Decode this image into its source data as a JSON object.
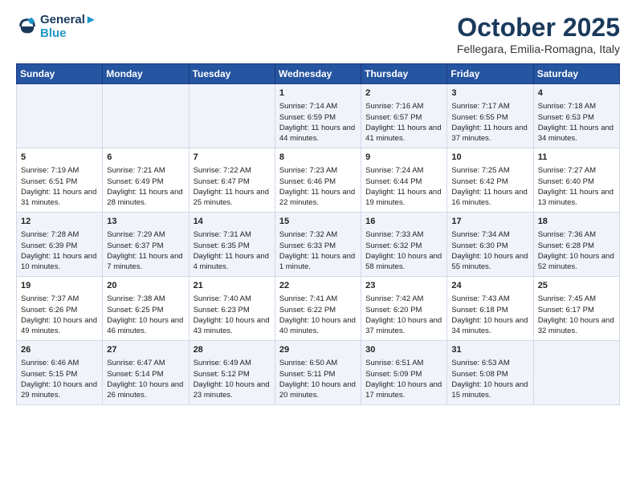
{
  "header": {
    "logo_line1": "General",
    "logo_line2": "Blue",
    "month": "October 2025",
    "location": "Fellegara, Emilia-Romagna, Italy"
  },
  "weekdays": [
    "Sunday",
    "Monday",
    "Tuesday",
    "Wednesday",
    "Thursday",
    "Friday",
    "Saturday"
  ],
  "weeks": [
    [
      {
        "day": "",
        "text": ""
      },
      {
        "day": "",
        "text": ""
      },
      {
        "day": "",
        "text": ""
      },
      {
        "day": "1",
        "text": "Sunrise: 7:14 AM\nSunset: 6:59 PM\nDaylight: 11 hours and 44 minutes."
      },
      {
        "day": "2",
        "text": "Sunrise: 7:16 AM\nSunset: 6:57 PM\nDaylight: 11 hours and 41 minutes."
      },
      {
        "day": "3",
        "text": "Sunrise: 7:17 AM\nSunset: 6:55 PM\nDaylight: 11 hours and 37 minutes."
      },
      {
        "day": "4",
        "text": "Sunrise: 7:18 AM\nSunset: 6:53 PM\nDaylight: 11 hours and 34 minutes."
      }
    ],
    [
      {
        "day": "5",
        "text": "Sunrise: 7:19 AM\nSunset: 6:51 PM\nDaylight: 11 hours and 31 minutes."
      },
      {
        "day": "6",
        "text": "Sunrise: 7:21 AM\nSunset: 6:49 PM\nDaylight: 11 hours and 28 minutes."
      },
      {
        "day": "7",
        "text": "Sunrise: 7:22 AM\nSunset: 6:47 PM\nDaylight: 11 hours and 25 minutes."
      },
      {
        "day": "8",
        "text": "Sunrise: 7:23 AM\nSunset: 6:46 PM\nDaylight: 11 hours and 22 minutes."
      },
      {
        "day": "9",
        "text": "Sunrise: 7:24 AM\nSunset: 6:44 PM\nDaylight: 11 hours and 19 minutes."
      },
      {
        "day": "10",
        "text": "Sunrise: 7:25 AM\nSunset: 6:42 PM\nDaylight: 11 hours and 16 minutes."
      },
      {
        "day": "11",
        "text": "Sunrise: 7:27 AM\nSunset: 6:40 PM\nDaylight: 11 hours and 13 minutes."
      }
    ],
    [
      {
        "day": "12",
        "text": "Sunrise: 7:28 AM\nSunset: 6:39 PM\nDaylight: 11 hours and 10 minutes."
      },
      {
        "day": "13",
        "text": "Sunrise: 7:29 AM\nSunset: 6:37 PM\nDaylight: 11 hours and 7 minutes."
      },
      {
        "day": "14",
        "text": "Sunrise: 7:31 AM\nSunset: 6:35 PM\nDaylight: 11 hours and 4 minutes."
      },
      {
        "day": "15",
        "text": "Sunrise: 7:32 AM\nSunset: 6:33 PM\nDaylight: 11 hours and 1 minute."
      },
      {
        "day": "16",
        "text": "Sunrise: 7:33 AM\nSunset: 6:32 PM\nDaylight: 10 hours and 58 minutes."
      },
      {
        "day": "17",
        "text": "Sunrise: 7:34 AM\nSunset: 6:30 PM\nDaylight: 10 hours and 55 minutes."
      },
      {
        "day": "18",
        "text": "Sunrise: 7:36 AM\nSunset: 6:28 PM\nDaylight: 10 hours and 52 minutes."
      }
    ],
    [
      {
        "day": "19",
        "text": "Sunrise: 7:37 AM\nSunset: 6:26 PM\nDaylight: 10 hours and 49 minutes."
      },
      {
        "day": "20",
        "text": "Sunrise: 7:38 AM\nSunset: 6:25 PM\nDaylight: 10 hours and 46 minutes."
      },
      {
        "day": "21",
        "text": "Sunrise: 7:40 AM\nSunset: 6:23 PM\nDaylight: 10 hours and 43 minutes."
      },
      {
        "day": "22",
        "text": "Sunrise: 7:41 AM\nSunset: 6:22 PM\nDaylight: 10 hours and 40 minutes."
      },
      {
        "day": "23",
        "text": "Sunrise: 7:42 AM\nSunset: 6:20 PM\nDaylight: 10 hours and 37 minutes."
      },
      {
        "day": "24",
        "text": "Sunrise: 7:43 AM\nSunset: 6:18 PM\nDaylight: 10 hours and 34 minutes."
      },
      {
        "day": "25",
        "text": "Sunrise: 7:45 AM\nSunset: 6:17 PM\nDaylight: 10 hours and 32 minutes."
      }
    ],
    [
      {
        "day": "26",
        "text": "Sunrise: 6:46 AM\nSunset: 5:15 PM\nDaylight: 10 hours and 29 minutes."
      },
      {
        "day": "27",
        "text": "Sunrise: 6:47 AM\nSunset: 5:14 PM\nDaylight: 10 hours and 26 minutes."
      },
      {
        "day": "28",
        "text": "Sunrise: 6:49 AM\nSunset: 5:12 PM\nDaylight: 10 hours and 23 minutes."
      },
      {
        "day": "29",
        "text": "Sunrise: 6:50 AM\nSunset: 5:11 PM\nDaylight: 10 hours and 20 minutes."
      },
      {
        "day": "30",
        "text": "Sunrise: 6:51 AM\nSunset: 5:09 PM\nDaylight: 10 hours and 17 minutes."
      },
      {
        "day": "31",
        "text": "Sunrise: 6:53 AM\nSunset: 5:08 PM\nDaylight: 10 hours and 15 minutes."
      },
      {
        "day": "",
        "text": ""
      }
    ]
  ]
}
